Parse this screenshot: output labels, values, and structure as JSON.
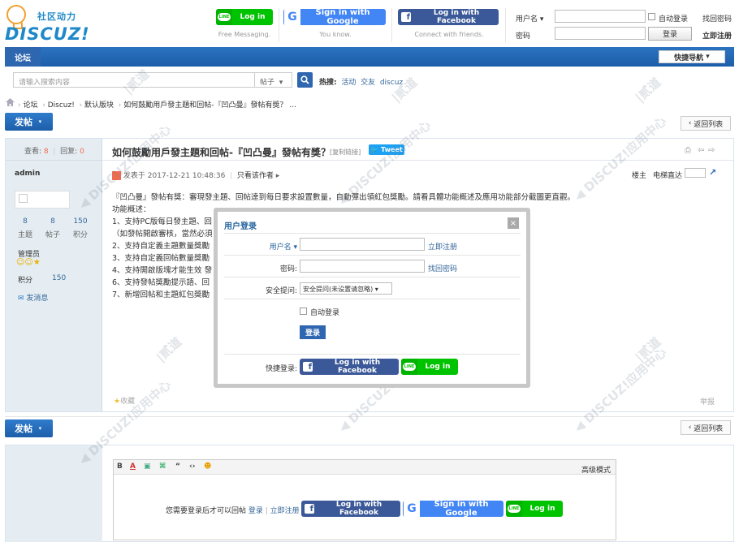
{
  "logo": {
    "sub": "社区动力",
    "main": "DISCUZ!"
  },
  "social": {
    "line_label": "Log in",
    "line_caption": "Free Messaging.",
    "google_label": "Sign in with Google",
    "google_caption": "You know.",
    "facebook_label": "Log in with Facebook",
    "facebook_caption": "Connect with friends."
  },
  "top_login": {
    "username_label": "用户名",
    "password_label": "密码",
    "auto_login": "自动登录",
    "login_button": "登录",
    "find_password": "找回密码",
    "register": "立即注册"
  },
  "nav": {
    "forum_tab": "论坛",
    "quick_nav": "快捷导航"
  },
  "search": {
    "placeholder": "请输入搜索内容",
    "type": "帖子",
    "hot_label": "热搜:",
    "hot_words": [
      "活动",
      "交友",
      "discuz"
    ]
  },
  "breadcrumb": [
    "论坛",
    "Discuz!",
    "默认版块",
    "如何鼓勵用戶發主題和回帖-『凹凸曼』發帖有獎？ ..."
  ],
  "buttons": {
    "post": "发帖",
    "back_list": "返回列表"
  },
  "thread": {
    "views_label": "查看:",
    "views": "8",
    "replies_label": "回复:",
    "replies": "0",
    "title": "如何鼓勵用戶發主題和回帖-『凹凸曼』發帖有獎？",
    "copy_link": "[复制链接]",
    "tweet": "Tweet",
    "posted_prefix": "发表于",
    "posted_time": "2017-12-21 10:48:36",
    "only_author": "只看该作者",
    "floor_label": "楼主",
    "jump_label": "电梯直达",
    "body": [
      "『凹凸曼』發帖有獎：審現發主題、回帖達到每日要求設置數量，自動彈出領紅包獎勵。請看具體功能概述及應用功能部分截圖更直觀。",
      "功能概述：",
      "1、支持PC版每日發主題、回",
      "（如發帖開啟審核，當然必須",
      "2、支持自定義主題數量獎勵",
      "3、支持自定義回帖數量獎勵",
      "4、支持開啟版塊才能生效 發",
      "6、支持發帖獎勵提示語、回",
      "7、新增回帖和主題紅包獎勵"
    ],
    "collect": "收藏",
    "report": "举报"
  },
  "author": {
    "name": "admin",
    "stats": [
      {
        "value": "8",
        "label": "主题"
      },
      {
        "value": "8",
        "label": "帖子"
      },
      {
        "value": "150",
        "label": "积分"
      }
    ],
    "group": "管理员",
    "points_label": "积分",
    "points": "150",
    "message": "发消息"
  },
  "modal": {
    "title": "用户登录",
    "close": "×",
    "username_label": "用户名",
    "register_link": "立即注册",
    "password_label": "密码:",
    "find_password": "找回密码",
    "question_label": "安全提问:",
    "question_value": "安全提问(未设置请忽略)",
    "auto_login": "自动登录",
    "submit": "登录",
    "quick_login_label": "快捷登录:",
    "facebook_label": "Log in with Facebook",
    "line_label": "Log in"
  },
  "editor": {
    "advanced_mode": "高级模式",
    "login_prompt": "您需要登录后才可以回帖",
    "login_link": "登录",
    "register_link": "立即注册",
    "facebook_label": "Log in with Facebook",
    "google_label": "Sign in with Google",
    "line_label": "Log in"
  },
  "colors": {
    "brand_blue": "#2b73c0",
    "line_green": "#00c300",
    "google_blue": "#4285f4",
    "facebook_blue": "#3b5998"
  }
}
